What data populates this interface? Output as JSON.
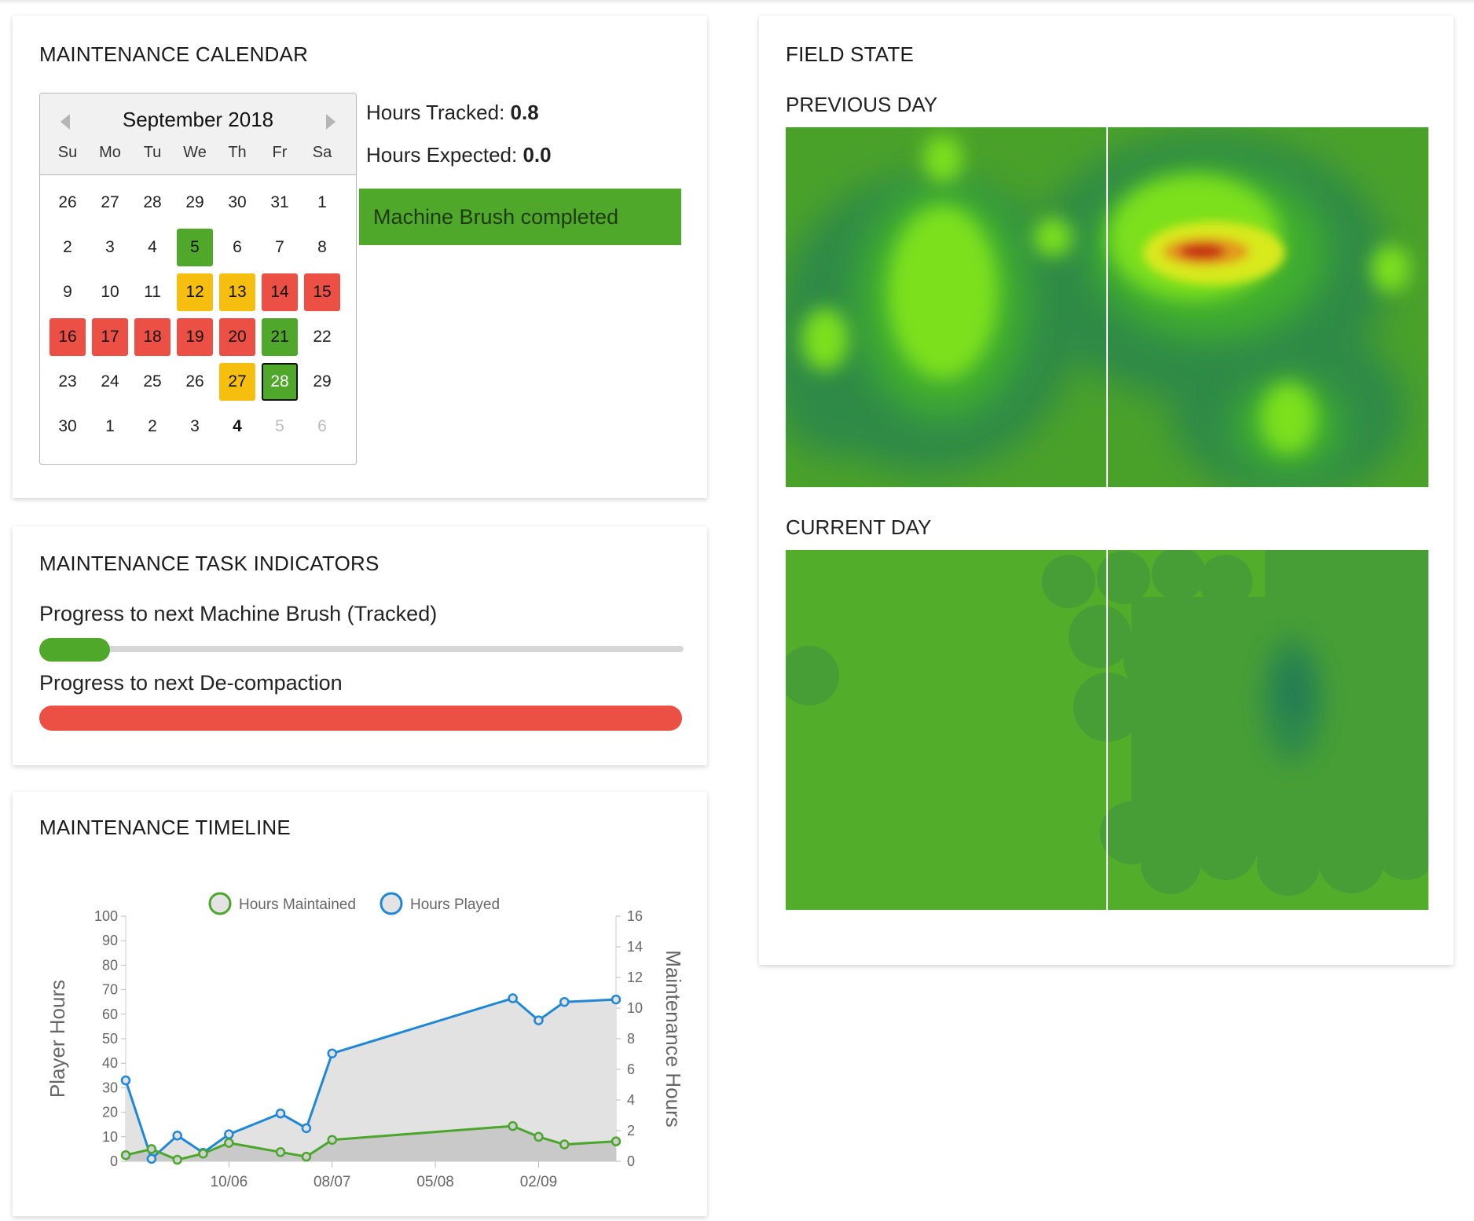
{
  "calendar_card": {
    "title": "MAINTENANCE CALENDAR",
    "month_label": "September 2018",
    "weekdays": [
      "Su",
      "Mo",
      "Tu",
      "We",
      "Th",
      "Fr",
      "Sa"
    ],
    "weeks": [
      [
        {
          "d": "26"
        },
        {
          "d": "27"
        },
        {
          "d": "28"
        },
        {
          "d": "29"
        },
        {
          "d": "30"
        },
        {
          "d": "31"
        },
        {
          "d": "1"
        }
      ],
      [
        {
          "d": "2"
        },
        {
          "d": "3"
        },
        {
          "d": "4"
        },
        {
          "d": "5",
          "s": "green"
        },
        {
          "d": "6"
        },
        {
          "d": "7"
        },
        {
          "d": "8"
        }
      ],
      [
        {
          "d": "9"
        },
        {
          "d": "10"
        },
        {
          "d": "11"
        },
        {
          "d": "12",
          "s": "yellow"
        },
        {
          "d": "13",
          "s": "yellow"
        },
        {
          "d": "14",
          "s": "red"
        },
        {
          "d": "15",
          "s": "red"
        }
      ],
      [
        {
          "d": "16",
          "s": "red"
        },
        {
          "d": "17",
          "s": "red"
        },
        {
          "d": "18",
          "s": "red"
        },
        {
          "d": "19",
          "s": "red"
        },
        {
          "d": "20",
          "s": "red"
        },
        {
          "d": "21",
          "s": "green"
        },
        {
          "d": "22"
        }
      ],
      [
        {
          "d": "23"
        },
        {
          "d": "24"
        },
        {
          "d": "25"
        },
        {
          "d": "26"
        },
        {
          "d": "27",
          "s": "yellow"
        },
        {
          "d": "28",
          "s": "green selected"
        },
        {
          "d": "29"
        }
      ],
      [
        {
          "d": "30"
        },
        {
          "d": "1"
        },
        {
          "d": "2"
        },
        {
          "d": "3"
        },
        {
          "d": "4",
          "s": "bold"
        },
        {
          "d": "5",
          "s": "muted"
        },
        {
          "d": "6",
          "s": "muted"
        }
      ]
    ],
    "hours_tracked_label": "Hours Tracked: ",
    "hours_tracked_value": "0.8",
    "hours_expected_label": "Hours Expected: ",
    "hours_expected_value": "0.0",
    "notice": "Machine Brush completed"
  },
  "task_card": {
    "title": "MAINTENANCE TASK INDICATORS",
    "progress_machine_brush_label": "Progress to next Machine Brush (Tracked)",
    "progress_machine_brush_fraction": 0.11,
    "progress_decompaction_label": "Progress to next De-compaction",
    "progress_decompaction_fraction": 1.0
  },
  "timeline_card": {
    "title": "MAINTENANCE TIMELINE"
  },
  "field_card": {
    "title": "FIELD STATE",
    "previous_label": "PREVIOUS DAY",
    "current_label": "CURRENT DAY"
  },
  "colors": {
    "green": "#50a82a",
    "yellow": "#f6bf0f",
    "red": "#ec4f43",
    "blue_series": "#1e88d6",
    "green_series": "#4aa72b"
  },
  "chart_data": {
    "type": "line",
    "legend": [
      "Hours Maintained",
      "Hours Played"
    ],
    "legend_position": "top",
    "x_tick_labels": [
      "10/06",
      "08/07",
      "05/08",
      "02/09"
    ],
    "x_index_range": [
      0,
      19
    ],
    "x_tick_positions": [
      4,
      8,
      12,
      16
    ],
    "ylabel": "Player Hours",
    "y2label": "Maintenance Hours",
    "ylim": [
      0,
      100
    ],
    "y_ticks": [
      0,
      10,
      20,
      30,
      40,
      50,
      60,
      70,
      80,
      90,
      100
    ],
    "y2lim": [
      0,
      16
    ],
    "y2_ticks": [
      0,
      2,
      4,
      6,
      8,
      10,
      12,
      14,
      16
    ],
    "series": [
      {
        "name": "Hours Played",
        "axis": "left",
        "x": [
          0,
          1,
          2,
          3,
          4,
          6,
          7,
          8,
          15,
          16,
          17,
          19
        ],
        "values": [
          33,
          1,
          10.5,
          3.5,
          11,
          19.5,
          13.5,
          44,
          66.5,
          57.5,
          65,
          66
        ]
      },
      {
        "name": "Hours Maintained",
        "axis": "right",
        "x": [
          0,
          1,
          2,
          3,
          4,
          6,
          7,
          8,
          15,
          16,
          17,
          19
        ],
        "values": [
          0.4,
          0.8,
          0.1,
          0.5,
          1.2,
          0.6,
          0.3,
          1.4,
          2.3,
          1.6,
          1.1,
          1.3
        ]
      }
    ]
  }
}
